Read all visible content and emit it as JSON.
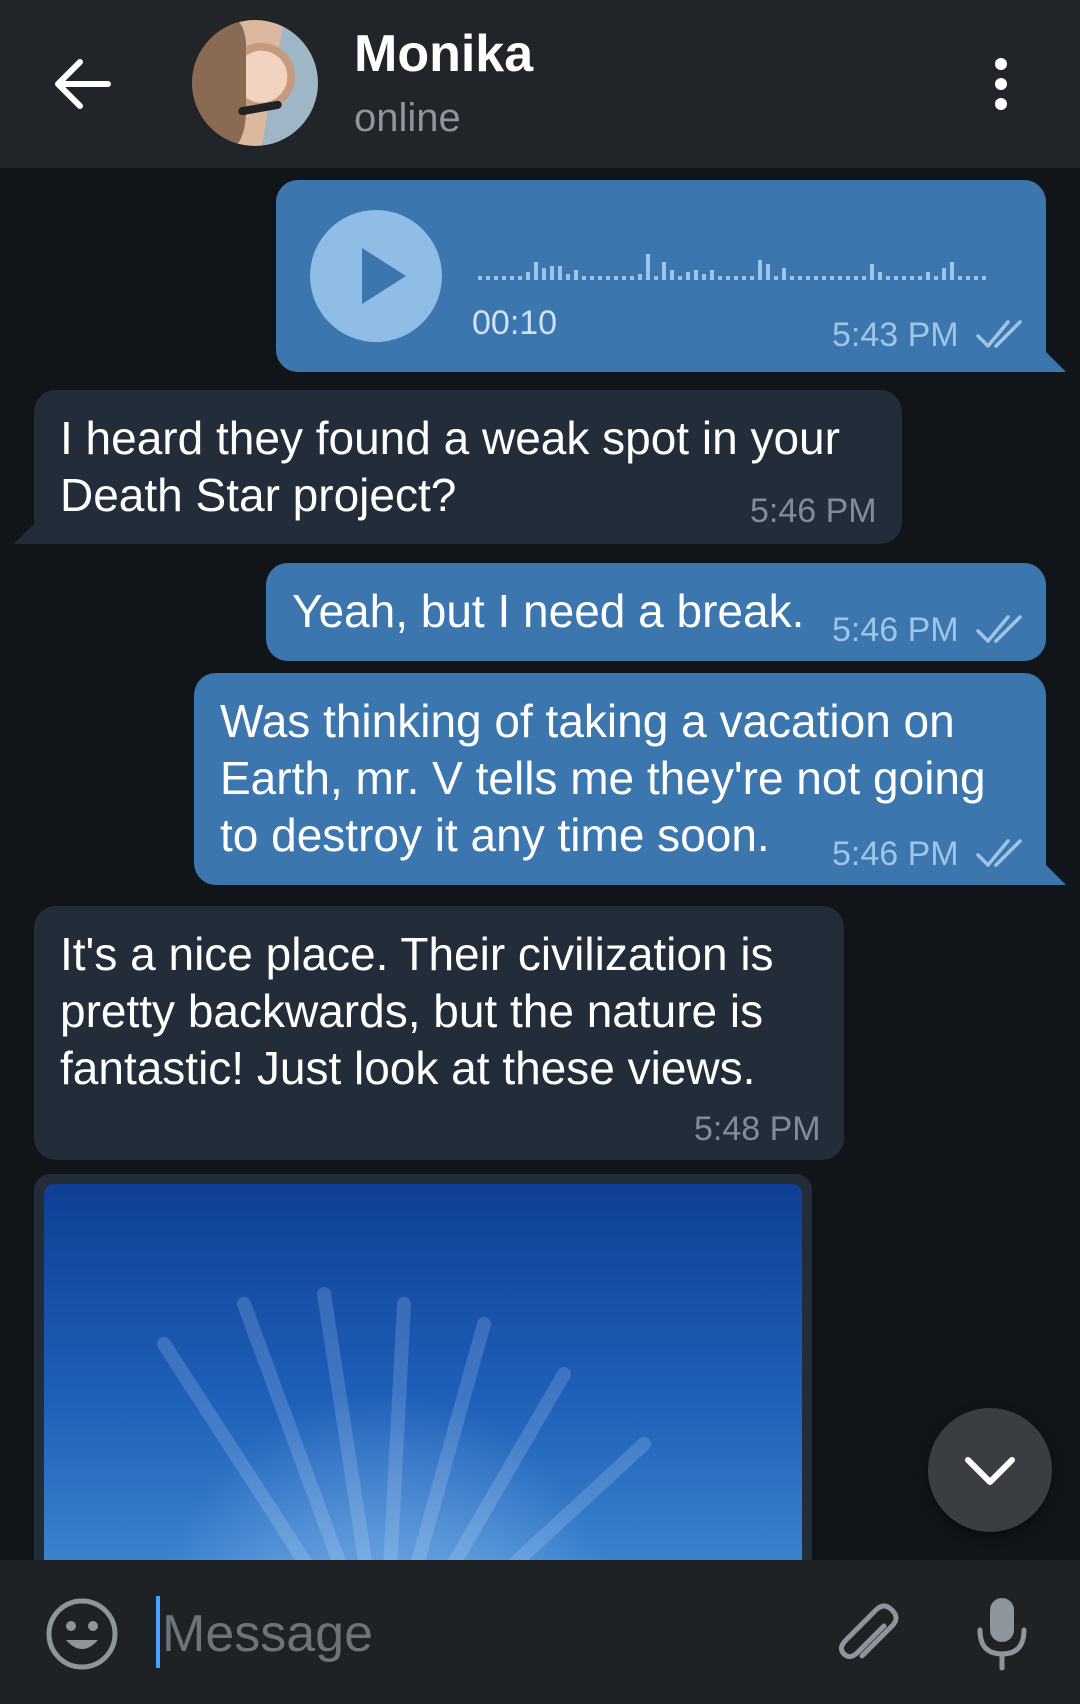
{
  "header": {
    "contact_name": "Monika",
    "status": "online"
  },
  "messages": [
    {
      "type": "voice",
      "direction": "outgoing",
      "duration": "00:10",
      "time": "5:43 PM",
      "read": true
    },
    {
      "type": "text",
      "direction": "incoming",
      "lines": [
        "I heard they found a weak spot in your",
        "Death Star project?"
      ],
      "time": "5:46 PM"
    },
    {
      "type": "text",
      "direction": "outgoing",
      "lines": [
        "Yeah, but I need a break."
      ],
      "time": "5:46 PM",
      "read": true
    },
    {
      "type": "text",
      "direction": "outgoing",
      "lines": [
        "Was thinking of taking a vacation on",
        "Earth, mr. V tells me they're not going",
        "to destroy it any time soon."
      ],
      "time": "5:46 PM",
      "read": true
    },
    {
      "type": "text",
      "direction": "incoming",
      "lines": [
        "It's a nice place. Their civilization is",
        "pretty backwards, but the nature is",
        "fantastic! Just look at these views."
      ],
      "time": "5:48 PM"
    },
    {
      "type": "photo",
      "direction": "incoming"
    }
  ],
  "composer": {
    "placeholder": "Message"
  },
  "colors": {
    "outgoing_bubble": "#3b76ae",
    "incoming_bubble": "#232d39",
    "background": "#11151a",
    "header": "#212428",
    "cursor": "#4aa3ff"
  },
  "icons": [
    "back-arrow-icon",
    "more-vert-icon",
    "play-icon",
    "double-check-icon",
    "chevron-down-icon",
    "emoji-icon",
    "paperclip-icon",
    "microphone-icon"
  ]
}
